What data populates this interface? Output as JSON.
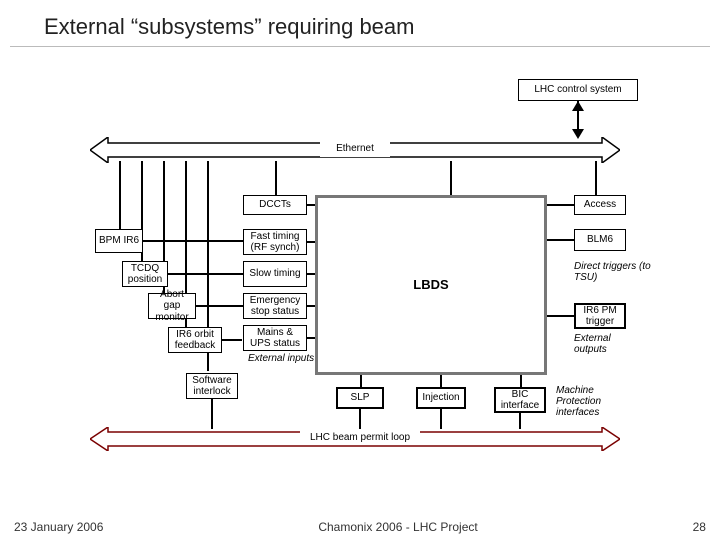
{
  "title": "External “subsystems” requiring beam",
  "header": {
    "lhc_control": "LHC control system"
  },
  "bus": {
    "ethernet": "Ethernet",
    "permit": "LHC beam permit loop"
  },
  "left": {
    "dccts": "DCCTs",
    "bpm": "BPM IR6",
    "tcdq": "TCDQ position",
    "abort": "Abort gap monitor",
    "orbit": "IR6 orbit feedback",
    "swi": "Software interlock"
  },
  "lbds_inputs": {
    "fast": "Fast timing (RF synch)",
    "slow": "Slow timing",
    "emergency": "Emergency stop status",
    "mains": "Mains & UPS status",
    "ext": "External inputs"
  },
  "center": {
    "lbds": "LBDS"
  },
  "right": {
    "access": "Access",
    "blm": "BLM6",
    "direct": "Direct triggers (to TSU)",
    "pm": "IR6 PM trigger",
    "extout": "External outputs"
  },
  "bottom": {
    "slp": "SLP",
    "injection": "Injection",
    "bic": "BIC interface",
    "mp": "Machine Protection interfaces"
  },
  "footer": {
    "date": "23 January 2006",
    "center": "Chamonix 2006 - LHC Project",
    "page": "28"
  }
}
